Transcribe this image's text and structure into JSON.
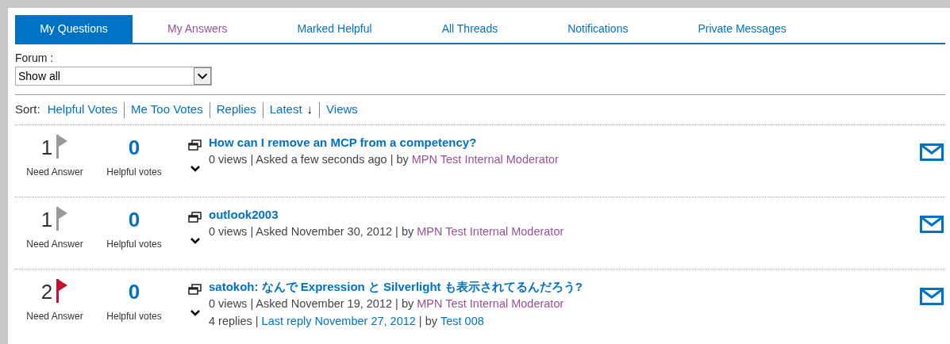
{
  "tabs": [
    {
      "label": "My Questions",
      "selected": true
    },
    {
      "label": "My Answers",
      "selected": false,
      "visited": true
    },
    {
      "label": "Marked Helpful",
      "selected": false,
      "visited": false
    },
    {
      "label": "All Threads",
      "selected": false,
      "visited": false
    },
    {
      "label": "Notifications",
      "selected": false,
      "visited": false
    },
    {
      "label": "Private Messages",
      "selected": false,
      "visited": false
    }
  ],
  "forum": {
    "label": "Forum :",
    "value": "Show all"
  },
  "sort": {
    "label": "Sort:",
    "options": [
      {
        "label": "Helpful Votes"
      },
      {
        "label": "Me Too Votes"
      },
      {
        "label": "Replies"
      },
      {
        "label": "Latest",
        "arrow": "↓"
      },
      {
        "label": "Views"
      }
    ]
  },
  "threads": [
    {
      "count": "1",
      "flagged": false,
      "count_label": "Need Answer",
      "votes": "0",
      "votes_label": "Helpful votes",
      "title": "How can I remove an MCP from a competency?",
      "meta": [
        [
          {
            "kind": "plain",
            "text": "0 views | Asked a few seconds ago | by"
          },
          {
            "kind": "visited",
            "text": "MPN Test Internal Moderator"
          }
        ]
      ]
    },
    {
      "count": "1",
      "flagged": false,
      "count_label": "Need Answer",
      "votes": "0",
      "votes_label": "Helpful votes",
      "title": "outlook2003",
      "meta": [
        [
          {
            "kind": "plain",
            "text": "0 views | Asked November 30, 2012 | by"
          },
          {
            "kind": "visited",
            "text": "MPN Test Internal Moderator"
          }
        ]
      ]
    },
    {
      "count": "2",
      "flagged": true,
      "count_label": "Need Answer",
      "votes": "0",
      "votes_label": "Helpful votes",
      "title": "satokoh: なんで Expression と Silverlight も表示されてるんだろう?",
      "meta": [
        [
          {
            "kind": "plain",
            "text": "0 views | Asked November 19, 2012 | by"
          },
          {
            "kind": "visited",
            "text": "MPN Test Internal Moderator"
          }
        ],
        [
          {
            "kind": "plain",
            "text": "4 replies |"
          },
          {
            "kind": "link",
            "text": "Last reply November 27, 2012"
          },
          {
            "kind": "plain",
            "text": "| by"
          },
          {
            "kind": "link",
            "text": "Test 008"
          }
        ]
      ]
    }
  ]
}
